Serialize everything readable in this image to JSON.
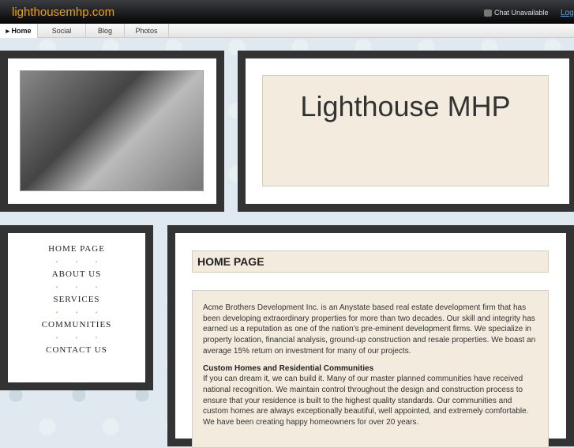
{
  "header": {
    "site": "lighthousemhp.com",
    "chat": "Chat Unavailable",
    "login": "Log"
  },
  "nav": [
    {
      "label": "▸ Home"
    },
    {
      "label": "Social"
    },
    {
      "label": "Blog"
    },
    {
      "label": "Photos"
    }
  ],
  "banner": {
    "title": "Lighthouse MHP"
  },
  "menu": [
    "HOME PAGE",
    "ABOUT US",
    "SERVICES",
    "COMMUNITIES",
    "CONTACT US"
  ],
  "dots": "• • •",
  "main": {
    "heading": "HOME PAGE",
    "p1": "Acme Brothers Development Inc. is an Anystate based real estate development firm that has been developing extraordinary properties for more than two decades. Our skill and integrity has earned us a reputation as one of the nation's pre-eminent development firms. We specialize in property location, financial analysis, ground-up construction and resale properties. We boast an average 15% return on investment for many of our projects.",
    "sub": "Custom Homes and Residential Communities",
    "p2": "If you can dream it, we can build it. Many of our master planned communities have received national recognition. We maintain control throughout the design and construction process to ensure that your residence is built to the highest quality standards. Our communities and custom homes are always exceptionally beautiful, well appointed, and extremely comfortable. We have been creating happy homeowners for over 20 years."
  }
}
